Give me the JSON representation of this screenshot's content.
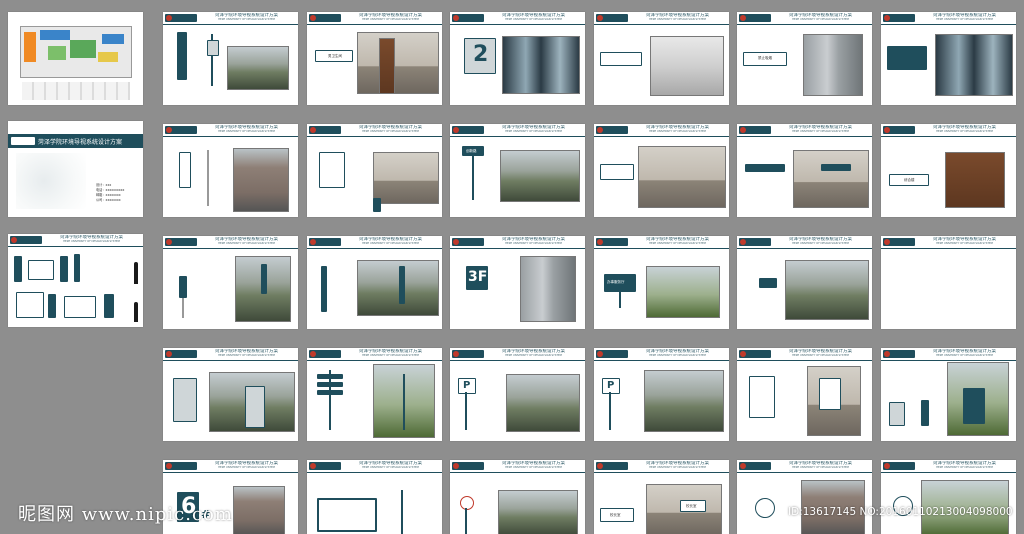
{
  "deck": {
    "slide_header_title": "菏泽学院环境导视系统设计方案",
    "slide_header_subtitle": "HEZE UNIVERSITY OF DESIGN SIGN SYSTEM",
    "cover": {
      "title": "菏泽学院环境导视系统设计方案",
      "info_lines": [
        "设计：xxx",
        "电话：xxxxxxxxxx",
        "邮箱：xxxxxxxx",
        "公司：xxxxxxxx"
      ]
    },
    "sign_labels": {
      "s1_2_plate": "男卫生间",
      "s1_3_number": "2",
      "s1_5_plate": "禁止吸烟",
      "s2_3_plate": "创新路",
      "s2_6_plate": "综合楼",
      "s3_3_floor": "3F",
      "s3_4_plate": "办事服务厅",
      "s5_1_number": "6",
      "s5_1_hash": "#",
      "s5_4_plate": "校长室",
      "s5_4_photo_plate": "校长室",
      "s4_3_letter": "P",
      "s4_4_letter": "P"
    }
  },
  "watermark": {
    "left": "昵图网 www.nipic.com",
    "right": "ID:13617145 NO:20160110213004098000"
  },
  "colors": {
    "brand": "#1f4e5c",
    "accent": "#c0392b",
    "background": "#8e8e8e"
  }
}
